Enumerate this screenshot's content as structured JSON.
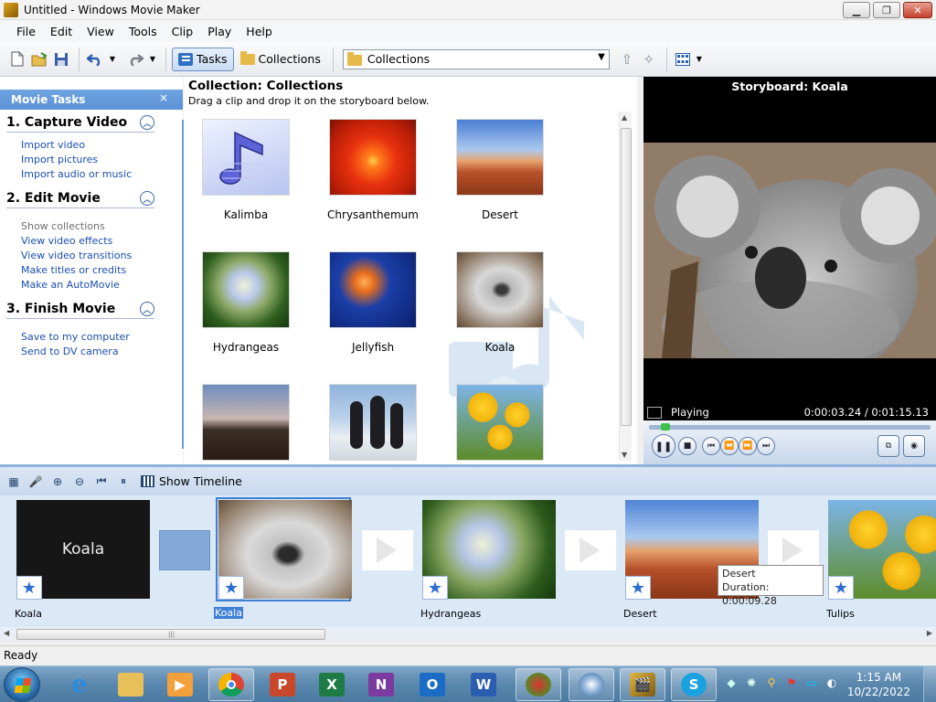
{
  "window": {
    "title": "Untitled - Windows Movie Maker"
  },
  "menu": [
    "File",
    "Edit",
    "View",
    "Tools",
    "Clip",
    "Play",
    "Help"
  ],
  "toolbar": {
    "tasks_label": "Tasks",
    "collections_label": "Collections",
    "combo_value": "Collections"
  },
  "tasks_pane": {
    "header": "Movie Tasks",
    "close": "×",
    "groups": [
      {
        "title": "1. Capture Video",
        "links": [
          "Import video",
          "Import pictures",
          "Import audio or music"
        ]
      },
      {
        "title": "2. Edit Movie",
        "links": [
          "Show collections",
          "View video effects",
          "View video transitions",
          "Make titles or credits",
          "Make an AutoMovie"
        ]
      },
      {
        "title": "3. Finish Movie",
        "links": [
          "Save to my computer",
          "Send to DV camera"
        ]
      }
    ]
  },
  "collection": {
    "title": "Collection: Collections",
    "hint": "Drag a clip and drop it on the storyboard below.",
    "clips": [
      {
        "name": "Kalimba",
        "thumb": "music-note"
      },
      {
        "name": "Chrysanthemum",
        "thumb": "flower-red"
      },
      {
        "name": "Desert",
        "thumb": "desert"
      },
      {
        "name": "Hydrangeas",
        "thumb": "hydrangeas"
      },
      {
        "name": "Jellyfish",
        "thumb": "jellyfish"
      },
      {
        "name": "Koala",
        "thumb": "koala"
      },
      {
        "name": "",
        "thumb": "lighthouse"
      },
      {
        "name": "",
        "thumb": "penguins"
      },
      {
        "name": "",
        "thumb": "tulips"
      }
    ]
  },
  "player": {
    "title": "Storyboard: Koala",
    "status": "Playing",
    "time": "0:00:03.24 / 0:01:15.13",
    "progress": 0.043
  },
  "storyboard": {
    "show_timeline": "Show Timeline",
    "clips": [
      {
        "label": "Koala",
        "thumb_text": "Koala",
        "kind": "title"
      },
      {
        "label": "Koala",
        "kind": "koala",
        "selected": true
      },
      {
        "label": "Hydrangeas",
        "kind": "hydrangeas"
      },
      {
        "label": "Desert",
        "kind": "desert"
      },
      {
        "label": "Tulips",
        "kind": "tulips"
      }
    ],
    "tooltip": {
      "line1": "Desert",
      "line2": "Duration: 0:00:09.28"
    }
  },
  "status_bar": "Ready",
  "taskbar": {
    "clock_time": "1:15 AM",
    "clock_date": "10/22/2022",
    "apps": [
      "internet-explorer",
      "file-explorer",
      "media-player",
      "chrome",
      "powerpoint",
      "excel",
      "onenote",
      "outlook",
      "word",
      "app-settings",
      "app-disc",
      "movie-maker",
      "skype"
    ]
  }
}
